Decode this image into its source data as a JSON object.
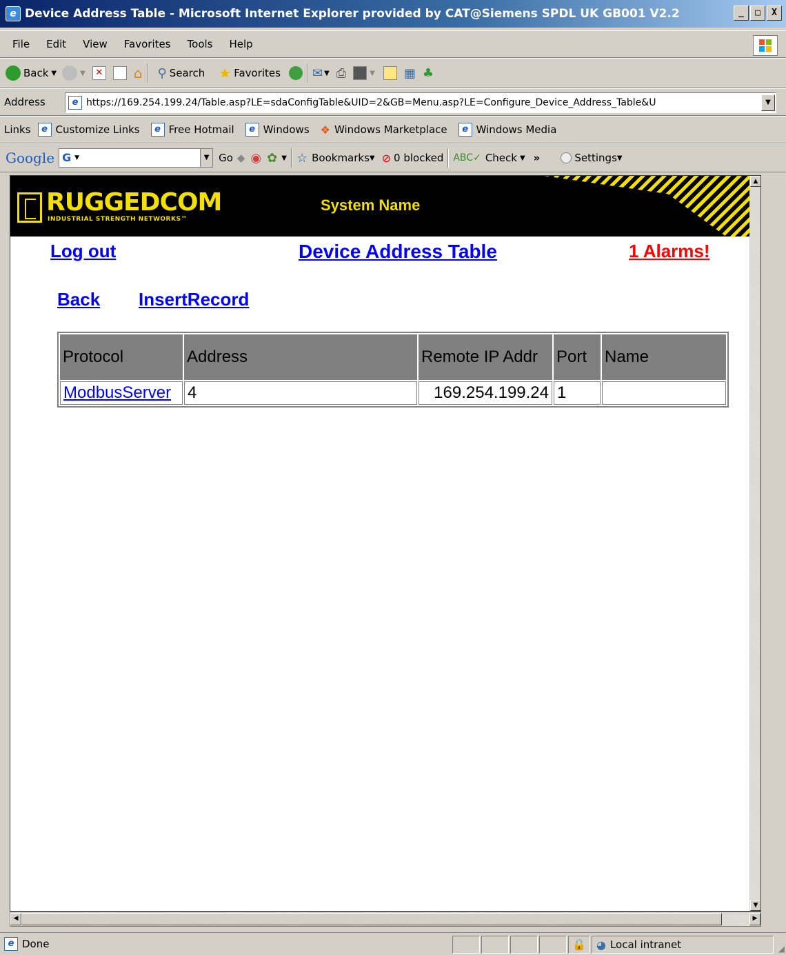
{
  "window": {
    "title": "Device Address Table - Microsoft Internet Explorer provided by CAT@Siemens SPDL UK GB001 V2.2",
    "controls": [
      "_",
      "□",
      "X"
    ]
  },
  "menu": [
    "File",
    "Edit",
    "View",
    "Favorites",
    "Tools",
    "Help"
  ],
  "toolbar": {
    "back": "Back",
    "search": "Search",
    "favorites": "Favorites"
  },
  "address": {
    "label": "Address",
    "url": "https://169.254.199.24/Table.asp?LE=sdaConfigTable&UID=2&GB=Menu.asp?LE=Configure_Device_Address_Table&U"
  },
  "links": {
    "label": "Links",
    "items": [
      "Customize Links",
      "Free Hotmail",
      "Windows",
      "Windows Marketplace",
      "Windows Media"
    ]
  },
  "google": {
    "logo": "Google",
    "go": "Go",
    "bookmarks": "Bookmarks",
    "blocked": "0 blocked",
    "check": "Check",
    "more": "»",
    "settings": "Settings"
  },
  "page": {
    "brand": "RUGGEDCOM",
    "tagline": "INDUSTRIAL STRENGTH NETWORKS™",
    "system_name": "System Name",
    "logout": "Log out",
    "title": "Device Address Table",
    "alarms": "1 Alarms!",
    "back": "Back",
    "insert": "InsertRecord",
    "table": {
      "headers": [
        "Protocol",
        "Address",
        "Remote IP Addr",
        "Port",
        "Name"
      ],
      "rows": [
        {
          "protocol": "ModbusServer",
          "address": "4",
          "remote_ip": "169.254.199.24",
          "port": "1",
          "name": ""
        }
      ]
    }
  },
  "status": {
    "text": "Done",
    "zone": "Local intranet"
  },
  "colors": {
    "brand_yellow": "#f3df00",
    "link_blue": "#0000ff",
    "alarm_red": "#ff0000",
    "table_header": "#808080"
  }
}
